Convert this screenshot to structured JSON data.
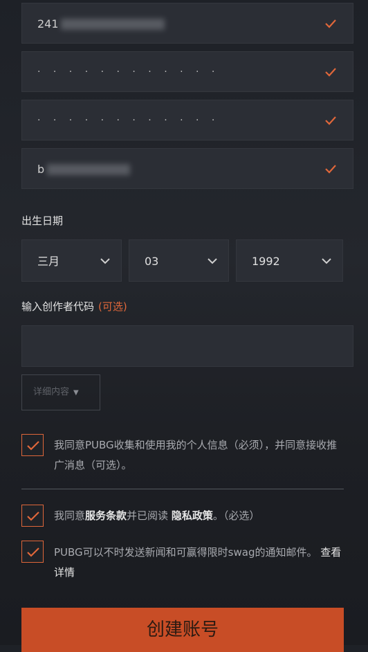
{
  "fields": {
    "field1_value": "241",
    "password_mask": "· · · · · · · · · · · ·",
    "confirm_mask": "· · · · · · · · · · · ·",
    "field4_value": "b"
  },
  "birth": {
    "label": "出生日期",
    "month": "三月",
    "day": "03",
    "year": "1992"
  },
  "creator": {
    "label": "输入创作者代码",
    "optional": "(可选)",
    "details": "详细内容"
  },
  "consents": {
    "c1": "我同意PUBG收集和使用我的个人信息（必须），并同意接收推广消息（可选）。",
    "c2_a": "我同意",
    "c2_terms": "服务条款",
    "c2_b": "并已阅读 ",
    "c2_privacy": "隐私政策",
    "c2_c": "。（必选）",
    "c3_a": "PUBG可以不时发送新闻和可赢得限时swag的通知邮件。 ",
    "c3_more": "查看详情"
  },
  "create_button": "创建账号",
  "colors": {
    "accent": "#e0673a",
    "button": "#c84d26",
    "field_bg": "#2b2e35"
  }
}
